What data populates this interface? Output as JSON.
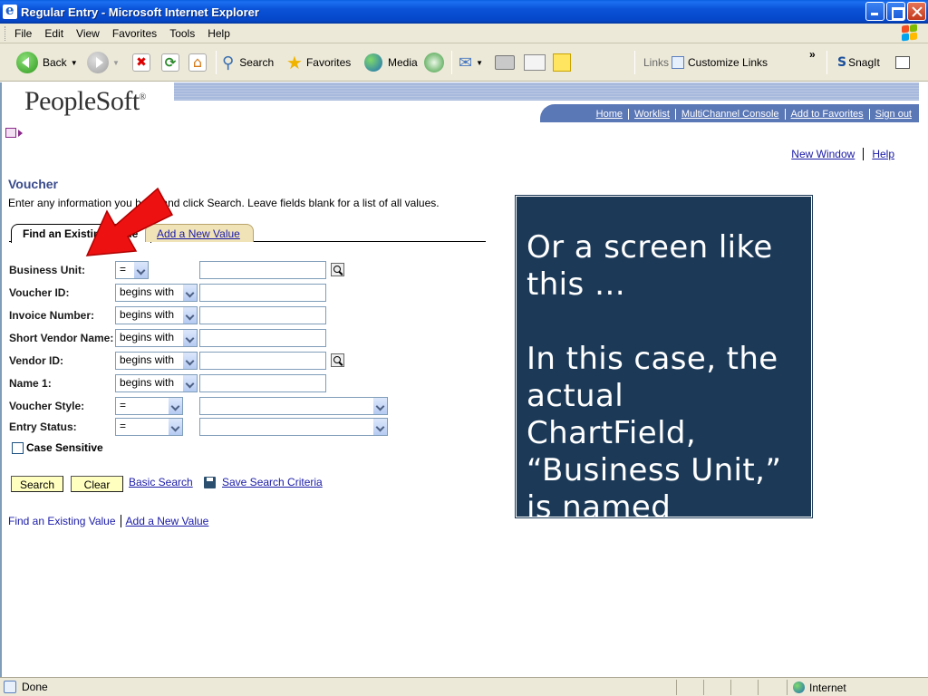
{
  "window": {
    "title": "Regular Entry - Microsoft Internet Explorer"
  },
  "menu": [
    "File",
    "Edit",
    "View",
    "Favorites",
    "Tools",
    "Help"
  ],
  "toolbar": {
    "back": "Back",
    "search": "Search",
    "favorites": "Favorites",
    "media": "Media",
    "links_label": "Links",
    "customize_links": "Customize Links",
    "snagit": "SnagIt",
    "chevron": "»"
  },
  "header": {
    "logo": "PeopleSoft",
    "logo_mark": "®",
    "links": [
      "Home",
      "Worklist",
      "MultiChannel Console",
      "Add to Favorites",
      "Sign out"
    ]
  },
  "top_links": {
    "new_window": "New Window",
    "help": "Help"
  },
  "page": {
    "title": "Voucher",
    "instructions": "Enter any information you have and click Search. Leave fields blank for a list of all values."
  },
  "tabs": {
    "active": "Find an Existing Value",
    "inactive": "Add a New Value"
  },
  "fields": [
    {
      "label": "Business Unit:",
      "operator": "=",
      "value": ""
    },
    {
      "label": "Voucher ID:",
      "operator": "begins with",
      "value": ""
    },
    {
      "label": "Invoice Number:",
      "operator": "begins with",
      "value": ""
    },
    {
      "label": "Short Vendor Name:",
      "operator": "begins with",
      "value": ""
    },
    {
      "label": "Vendor ID:",
      "operator": "begins with",
      "value": ""
    },
    {
      "label": "Name 1:",
      "operator": "begins with",
      "value": ""
    },
    {
      "label": "Voucher Style:",
      "operator": "=",
      "value": ""
    },
    {
      "label": "Entry Status:",
      "operator": "=",
      "value": ""
    }
  ],
  "case_sensitive": "Case Sensitive",
  "buttons": {
    "search": "Search",
    "clear": "Clear"
  },
  "links": {
    "basic_search": "Basic Search",
    "save_search": "Save Search Criteria"
  },
  "footer_nav": {
    "find": "Find an Existing Value",
    "add": "Add a New Value"
  },
  "callout": {
    "text": "Or a screen like this …\n\nIn this case, the actual ChartField, “Business Unit,” is named"
  },
  "status": {
    "text": "Done",
    "zone": "Internet"
  },
  "colors": {
    "callout_bg": "#1c3a58",
    "arrow": "#ee1111",
    "button_bg": "#ffffc0",
    "title_blue": "#0a52d8"
  }
}
